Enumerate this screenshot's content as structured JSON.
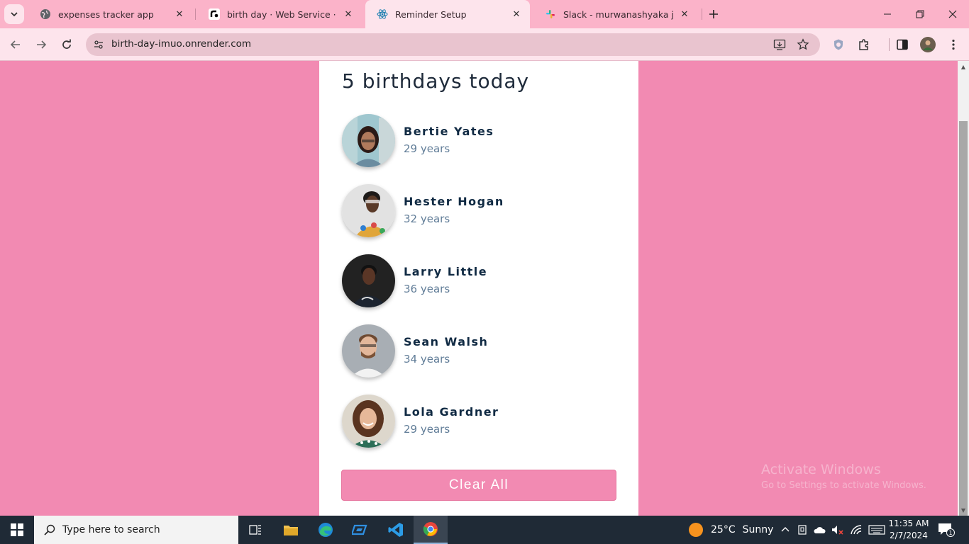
{
  "browser": {
    "tabs": [
      {
        "title": "expenses tracker app",
        "icon": "globe-icon"
      },
      {
        "title": "birth day · Web Service · Render",
        "icon": "render-icon"
      },
      {
        "title": "Reminder Setup",
        "icon": "react-icon",
        "active": true
      },
      {
        "title": "Slack - murwanashyaka jean claude",
        "icon": "slack-icon"
      }
    ],
    "url": "birth-day-imuo.onrender.com"
  },
  "page": {
    "heading": "5 birthdays today",
    "people": [
      {
        "name": "Bertie Yates",
        "age": "29 years"
      },
      {
        "name": "Hester Hogan",
        "age": "32 years"
      },
      {
        "name": "Larry Little",
        "age": "36 years"
      },
      {
        "name": "Sean Walsh",
        "age": "34 years"
      },
      {
        "name": "Lola Gardner",
        "age": "29 years"
      }
    ],
    "clear_button": "Clear All"
  },
  "watermark": {
    "line1": "Activate Windows",
    "line2": "Go to Settings to activate Windows."
  },
  "taskbar": {
    "search_placeholder": "Type here to search",
    "weather_temp": "25°C",
    "weather_text": "Sunny",
    "time": "11:35 AM",
    "date": "2/7/2024",
    "notification_count": "1"
  },
  "colors": {
    "accent": "#f28ab2",
    "tab_strip": "#fbb3c9",
    "toolbar": "#fde4ec",
    "name_text": "#102a43",
    "age_text": "#617d98"
  }
}
